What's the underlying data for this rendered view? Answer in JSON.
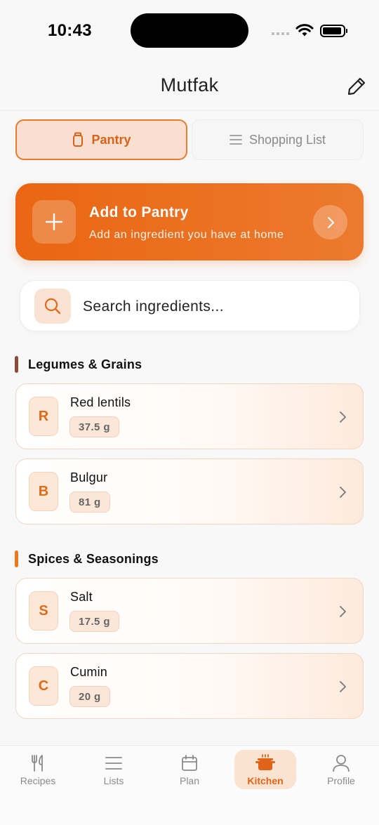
{
  "status_bar": {
    "time": "10:43"
  },
  "header": {
    "title": "Mutfak",
    "edit_icon": "pencil-icon"
  },
  "tabs": [
    {
      "label": "Pantry",
      "icon": "jar-icon",
      "active": true
    },
    {
      "label": "Shopping List",
      "icon": "list-icon",
      "active": false
    }
  ],
  "add_card": {
    "title": "Add to Pantry",
    "subtitle": "Add an ingredient you have at home",
    "icon": "plus-icon",
    "arrow_icon": "chevron-right-icon",
    "color_start": "#ea6612",
    "color_end": "#ec7a2e"
  },
  "search": {
    "placeholder": "Search ingredients...",
    "value": "",
    "icon": "search-icon"
  },
  "sections": [
    {
      "title": "Legumes & Grains",
      "accent": "#8a4b3a",
      "items": [
        {
          "initial": "R",
          "name": "Red lentils",
          "quantity": "37.5 g"
        },
        {
          "initial": "B",
          "name": "Bulgur",
          "quantity": "81 g"
        }
      ]
    },
    {
      "title": "Spices & Seasonings",
      "accent": "#ec7a1c",
      "items": [
        {
          "initial": "S",
          "name": "Salt",
          "quantity": "17.5 g"
        },
        {
          "initial": "C",
          "name": "Cumin",
          "quantity": "20 g"
        }
      ]
    }
  ],
  "tab_bar": [
    {
      "label": "Recipes",
      "icon": "fork-knife-icon",
      "active": false
    },
    {
      "label": "Lists",
      "icon": "list-icon",
      "active": false
    },
    {
      "label": "Plan",
      "icon": "calendar-icon",
      "active": false
    },
    {
      "label": "Kitchen",
      "icon": "pot-icon",
      "active": true
    },
    {
      "label": "Profile",
      "icon": "person-icon",
      "active": false
    }
  ],
  "colors": {
    "accent": "#ea6612",
    "accent_soft": "#fbe3d2",
    "background": "#f8f8f8"
  }
}
